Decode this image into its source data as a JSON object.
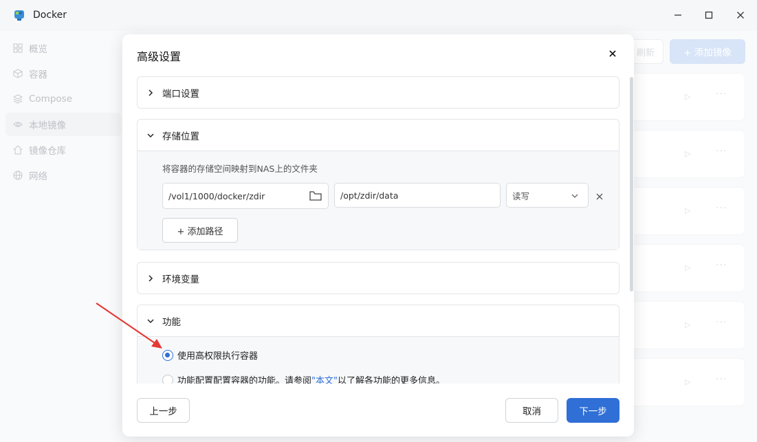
{
  "window": {
    "title": "Docker"
  },
  "sidebar": {
    "items": [
      {
        "label": "概览",
        "icon": "grid-icon"
      },
      {
        "label": "容器",
        "icon": "cube-icon"
      },
      {
        "label": "Compose",
        "icon": "layers-icon"
      },
      {
        "label": "本地镜像",
        "icon": "eye-icon",
        "active": true
      },
      {
        "label": "镜像仓库",
        "icon": "home-icon"
      },
      {
        "label": "网络",
        "icon": "globe-icon"
      }
    ]
  },
  "toolbar": {
    "refresh_label": "刷新",
    "add_image_label": "+ 添加镜像"
  },
  "modal": {
    "title": "高级设置",
    "sections": {
      "ports": {
        "title": "端口设置",
        "expanded": false
      },
      "storage": {
        "title": "存储位置",
        "expanded": true,
        "hint": "将容器的存储空间映射到NAS上的文件夹",
        "host_path": "/vol1/1000/docker/zdir",
        "container_path": "/opt/zdir/data",
        "mode": "读写",
        "add_path_label": "+ 添加路径"
      },
      "env": {
        "title": "环境变量",
        "expanded": false
      },
      "features": {
        "title": "功能",
        "expanded": true,
        "option_privileged": "使用高权限执行容器",
        "option_caps_before": "功能配置配置容器的功能。请参阅",
        "option_caps_link": "\"本文\"",
        "option_caps_after": "以了解各功能的更多信息。"
      }
    },
    "buttons": {
      "prev": "上一步",
      "cancel": "取消",
      "next": "下一步"
    }
  },
  "colors": {
    "accent": "#2f6fd6",
    "annotation_arrow": "#e53935"
  }
}
